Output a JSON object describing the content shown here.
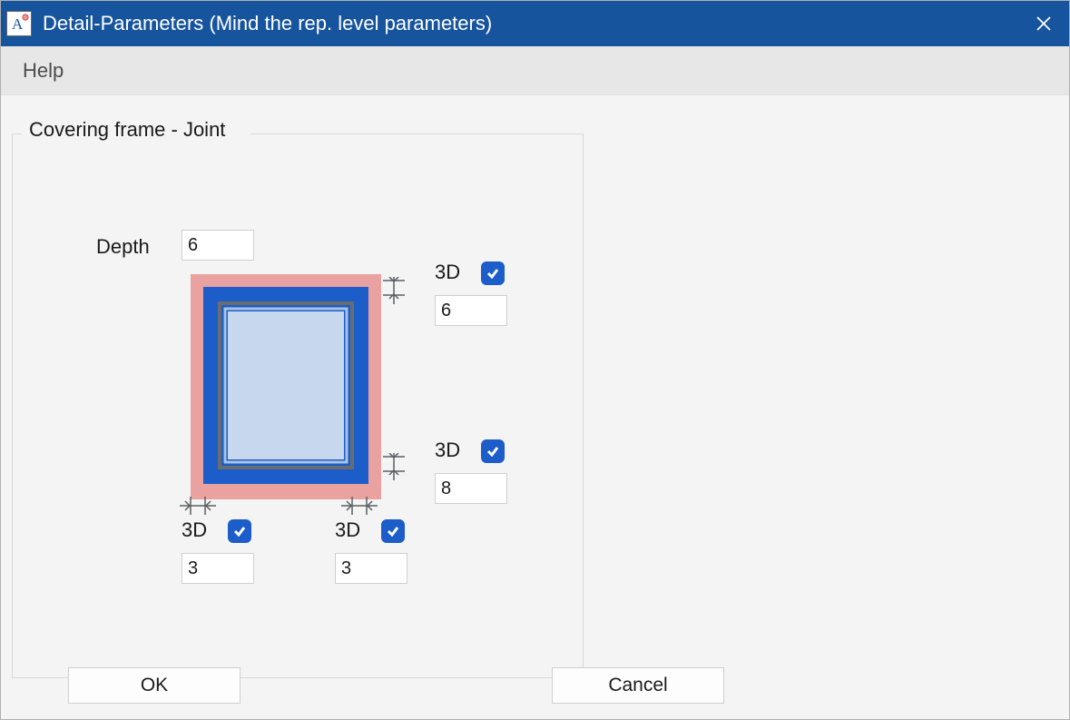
{
  "window_title": "Detail-Parameters (Mind the rep. level parameters)",
  "menu": {
    "help": "Help"
  },
  "group": {
    "legend": "Covering frame - Joint"
  },
  "depth": {
    "label": "Depth",
    "value": "6"
  },
  "joints": {
    "top": {
      "label3d": "3D",
      "checked": true,
      "value": "6"
    },
    "right": {
      "label3d": "3D",
      "checked": true,
      "value": "8"
    },
    "bottom_left": {
      "label3d": "3D",
      "checked": true,
      "value": "3"
    },
    "bottom_right": {
      "label3d": "3D",
      "checked": true,
      "value": "3"
    }
  },
  "buttons": {
    "ok": "OK",
    "cancel": "Cancel"
  },
  "colors": {
    "accent": "#1c5dc9",
    "outer_frame": "#e9a2a0",
    "inner_frame": "#1c5dc9",
    "glass_border": "#8a8d90",
    "glass_inner_border": "#a9c2e3",
    "glass_fill": "#c6d7ee",
    "titlebar": "#17549e"
  }
}
